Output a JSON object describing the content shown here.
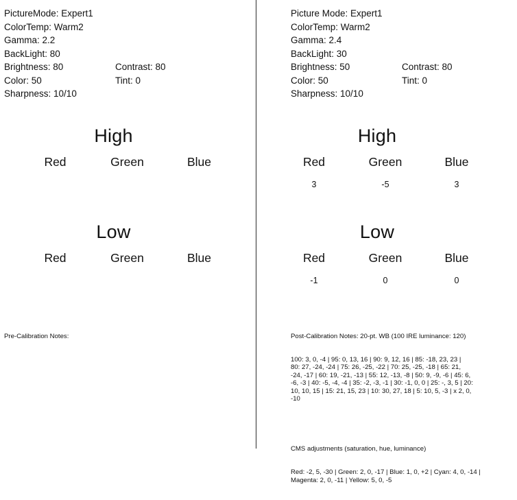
{
  "panels": {
    "left": {
      "settings": {
        "picture_mode": "PictureMode: Expert1",
        "color_temp": "ColorTemp: Warm2",
        "gamma": "Gamma: 2.2",
        "backlight": "BackLight: 80",
        "brightness": "Brightness: 80",
        "contrast": "Contrast: 80",
        "color": "Color: 50",
        "tint": "Tint: 0",
        "sharpness": "Sharpness: 10/10"
      },
      "high": {
        "title": "High",
        "channels": [
          {
            "name": "Red",
            "value": ""
          },
          {
            "name": "Green",
            "value": ""
          },
          {
            "name": "Blue",
            "value": ""
          }
        ]
      },
      "low": {
        "title": "Low",
        "channels": [
          {
            "name": "Red",
            "value": ""
          },
          {
            "name": "Green",
            "value": ""
          },
          {
            "name": "Blue",
            "value": ""
          }
        ]
      },
      "notes": {
        "heading": "Pre-Calibration Notes:",
        "body": ""
      }
    },
    "right": {
      "settings": {
        "picture_mode": "Picture Mode: Expert1",
        "color_temp": "ColorTemp: Warm2",
        "gamma": "Gamma: 2.4",
        "backlight": "BackLight: 30",
        "brightness": "Brightness: 50",
        "contrast": "Contrast: 80",
        "color": "Color: 50",
        "tint": "Tint: 0",
        "sharpness": "Sharpness: 10/10"
      },
      "high": {
        "title": "High",
        "channels": [
          {
            "name": "Red",
            "value": "3"
          },
          {
            "name": "Green",
            "value": "-5"
          },
          {
            "name": "Blue",
            "value": "3"
          }
        ]
      },
      "low": {
        "title": "Low",
        "channels": [
          {
            "name": "Red",
            "value": "-1"
          },
          {
            "name": "Green",
            "value": "0"
          },
          {
            "name": "Blue",
            "value": "0"
          }
        ]
      },
      "notes": {
        "heading": "Post-Calibration Notes: 20-pt. WB (100 IRE luminance: 120)",
        "body": "100: 3, 0, -4 | 95: 0, 13, 16 | 90: 9, 12, 16 | 85: -18, 23, 23 |\n80: 27, -24, -24 | 75: 26, -25, -22 | 70: 25, -25, -18 | 65: 21,\n-24, -17 | 60: 19, -21, -13 | 55: 12, -13, -8 | 50: 9, -9, -6 | 45: 6,\n-6, -3 | 40: -5, -4, -4 | 35: -2, -3, -1 | 30: -1, 0, 0 | 25: -, 3, 5 | 20:\n10, 10, 15 | 15: 21, 15, 23 | 10: 30, 27, 18 | 5: 10, 5, -3 | x 2, 0,\n-10",
        "cms_heading": "CMS adjustments (saturation, hue, luminance)",
        "cms_body": "Red: -2, 5, -30 | Green: 2, 0, -17 | Blue: 1, 0, +2 | Cyan: 4, 0, -14 |\nMagenta: 2, 0, -11 | Yellow: 5, 0, -5"
      }
    }
  }
}
